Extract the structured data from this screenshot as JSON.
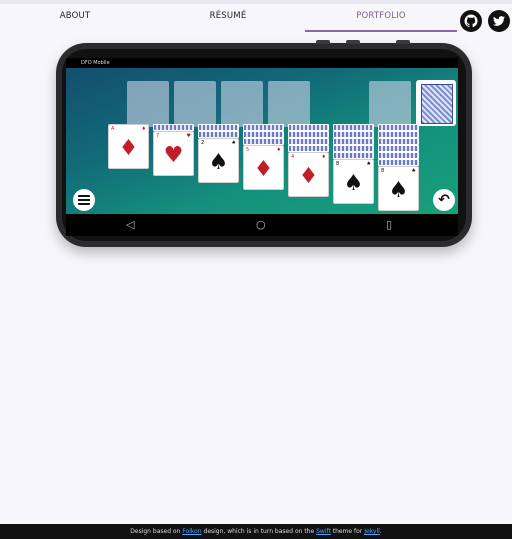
{
  "nav": {
    "tabs": [
      {
        "label": "ABOUT"
      },
      {
        "label": "RÉSUMÉ"
      },
      {
        "label": "PORTFOLIO"
      }
    ],
    "social": [
      {
        "icon": "github-icon"
      },
      {
        "icon": "twitter-icon"
      }
    ]
  },
  "phone": {
    "status_text": "DFO Mobile",
    "foundations": [
      "",
      "",
      "",
      ""
    ],
    "tableau": [
      {
        "face_down": 0,
        "rank": "A",
        "suit": "♦",
        "color": "red"
      },
      {
        "face_down": 1,
        "rank": "7",
        "suit": "♥",
        "color": "red"
      },
      {
        "face_down": 2,
        "rank": "2",
        "suit": "♠",
        "color": "black"
      },
      {
        "face_down": 3,
        "rank": "5",
        "suit": "♦",
        "color": "red"
      },
      {
        "face_down": 4,
        "rank": "4",
        "suit": "♦",
        "color": "red"
      },
      {
        "face_down": 5,
        "rank": "8",
        "suit": "♠",
        "color": "black"
      },
      {
        "face_down": 6,
        "rank": "8",
        "suit": "♠",
        "color": "black"
      }
    ],
    "menu_icon": "hamburger-menu-icon",
    "undo_icon": "undo-icon",
    "navbar": {
      "back": "◁",
      "home": "○",
      "recents": "▯"
    }
  },
  "footer": {
    "t1": "Design based on ",
    "l1": "Folkon",
    "t2": " design, which is in turn based on the ",
    "l2": "Swift",
    "t3": " theme for ",
    "l3": "Jekyll",
    "t4": "."
  }
}
